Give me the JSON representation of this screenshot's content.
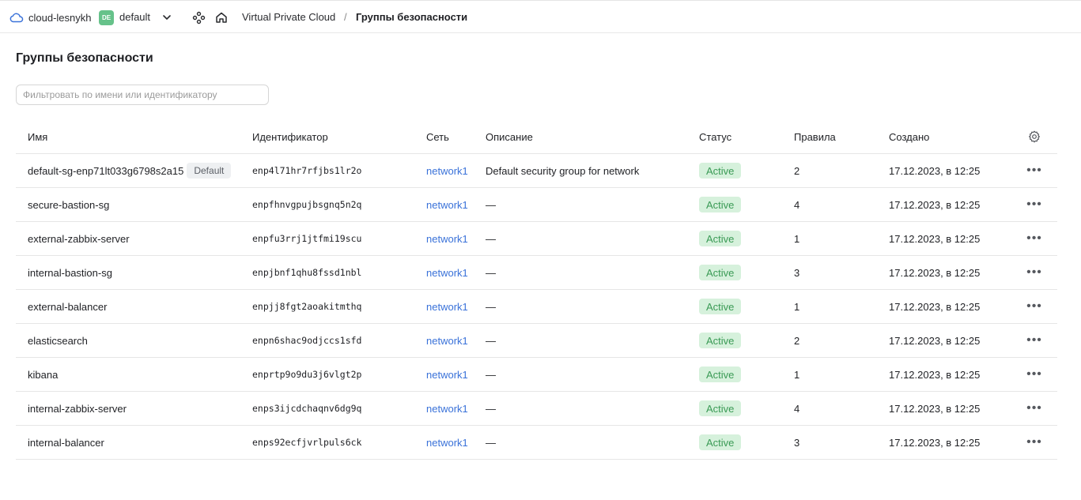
{
  "header": {
    "cloud_name": "cloud-lesnykh",
    "folder_badge": "DE",
    "folder_name": "default",
    "breadcrumb": {
      "service": "Virtual Private Cloud",
      "separator": "/",
      "current": "Группы безопасности"
    }
  },
  "page": {
    "title": "Группы безопасности",
    "filter_placeholder": "Фильтровать по имени или идентификатору",
    "filter_value": ""
  },
  "table": {
    "columns": [
      "Имя",
      "Идентификатор",
      "Сеть",
      "Описание",
      "Статус",
      "Правила",
      "Создано"
    ],
    "rows": [
      {
        "name": "default-sg-enp71lt033g6798s2a15",
        "badge": "Default",
        "id": "enp4l71hr7rfjbs1lr2o",
        "network": "network1",
        "description": "Default security group for network",
        "status": "Active",
        "rules": "2",
        "created": "17.12.2023, в 12:25"
      },
      {
        "name": "secure-bastion-sg",
        "badge": "",
        "id": "enpfhnvgpujbsgnq5n2q",
        "network": "network1",
        "description": "—",
        "status": "Active",
        "rules": "4",
        "created": "17.12.2023, в 12:25"
      },
      {
        "name": "external-zabbix-server",
        "badge": "",
        "id": "enpfu3rrj1jtfmi19scu",
        "network": "network1",
        "description": "—",
        "status": "Active",
        "rules": "1",
        "created": "17.12.2023, в 12:25"
      },
      {
        "name": "internal-bastion-sg",
        "badge": "",
        "id": "enpjbnf1qhu8fssd1nbl",
        "network": "network1",
        "description": "—",
        "status": "Active",
        "rules": "3",
        "created": "17.12.2023, в 12:25"
      },
      {
        "name": "external-balancer",
        "badge": "",
        "id": "enpjj8fgt2aoakitmthq",
        "network": "network1",
        "description": "—",
        "status": "Active",
        "rules": "1",
        "created": "17.12.2023, в 12:25"
      },
      {
        "name": "elasticsearch",
        "badge": "",
        "id": "enpn6shac9odjccs1sfd",
        "network": "network1",
        "description": "—",
        "status": "Active",
        "rules": "2",
        "created": "17.12.2023, в 12:25"
      },
      {
        "name": "kibana",
        "badge": "",
        "id": "enprtp9o9du3j6vlgt2p",
        "network": "network1",
        "description": "—",
        "status": "Active",
        "rules": "1",
        "created": "17.12.2023, в 12:25"
      },
      {
        "name": "internal-zabbix-server",
        "badge": "",
        "id": "enps3ijcdchaqnv6dg9q",
        "network": "network1",
        "description": "—",
        "status": "Active",
        "rules": "4",
        "created": "17.12.2023, в 12:25"
      },
      {
        "name": "internal-balancer",
        "badge": "",
        "id": "enps92ecfjvrlpuls6ck",
        "network": "network1",
        "description": "—",
        "status": "Active",
        "rules": "3",
        "created": "17.12.2023, в 12:25"
      }
    ],
    "row_actions_label": "•••"
  },
  "colors": {
    "link": "#3a72d9",
    "status_bg": "#d6f1dc",
    "status_text": "#3a9a55",
    "folder_badge_bg": "#66c28a"
  },
  "icons": {
    "cloud": "cloud-icon",
    "chevron": "chevron-down-icon",
    "services": "services-icon",
    "home": "home-icon",
    "settings": "gear-icon",
    "row_menu": "more-horizontal-icon"
  }
}
